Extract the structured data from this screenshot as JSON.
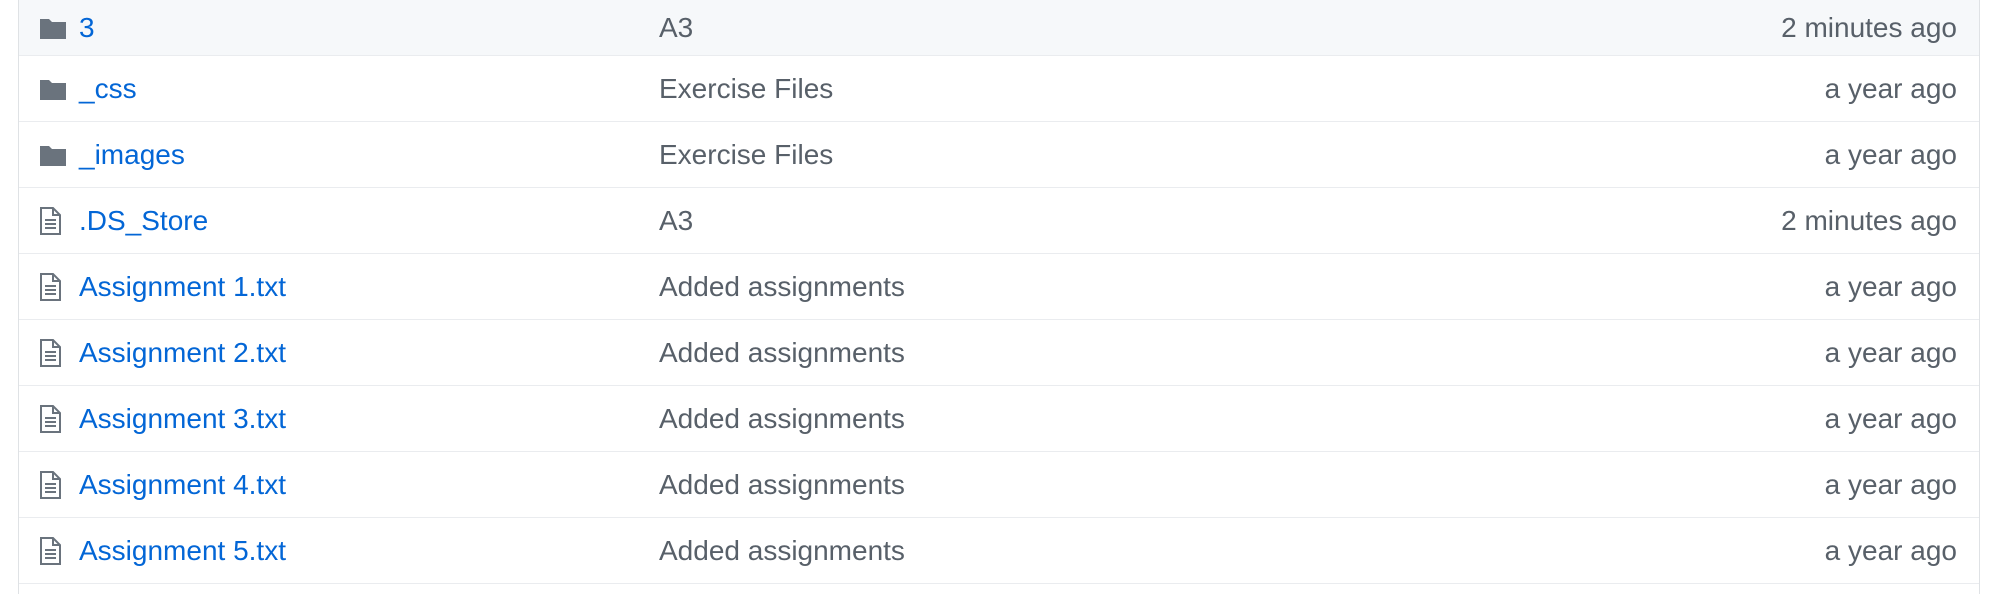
{
  "colors": {
    "link": "#0366d6",
    "muted_text": "#586069",
    "folder_icon": "#79b8ff",
    "file_icon": "#6a737d",
    "row_border": "#eaecef",
    "highlight_row": "#f6f8fa"
  },
  "files": [
    {
      "icon": "folder-icon",
      "name": "3",
      "message": "A3",
      "age": "2 minutes ago"
    },
    {
      "icon": "folder-icon",
      "name": "_css",
      "message": "Exercise Files",
      "age": "a year ago"
    },
    {
      "icon": "folder-icon",
      "name": "_images",
      "message": "Exercise Files",
      "age": "a year ago"
    },
    {
      "icon": "file-icon",
      "name": ".DS_Store",
      "message": "A3",
      "age": "2 minutes ago"
    },
    {
      "icon": "file-icon",
      "name": "Assignment 1.txt",
      "message": "Added assignments",
      "age": "a year ago"
    },
    {
      "icon": "file-icon",
      "name": "Assignment 2.txt",
      "message": "Added assignments",
      "age": "a year ago"
    },
    {
      "icon": "file-icon",
      "name": "Assignment 3.txt",
      "message": "Added assignments",
      "age": "a year ago"
    },
    {
      "icon": "file-icon",
      "name": "Assignment 4.txt",
      "message": "Added assignments",
      "age": "a year ago"
    },
    {
      "icon": "file-icon",
      "name": "Assignment 5.txt",
      "message": "Added assignments",
      "age": "a year ago"
    }
  ]
}
